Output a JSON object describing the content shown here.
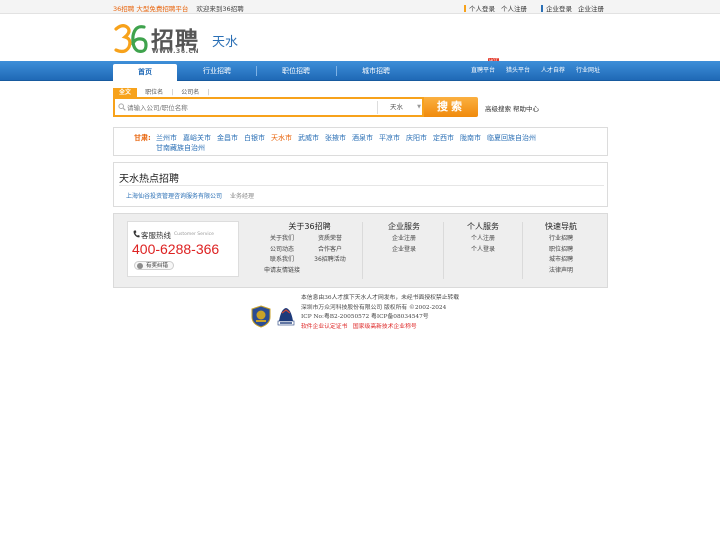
{
  "topbar": {
    "brand": "36招聘 大型免费招聘平台",
    "welcome": "欢迎来到36招聘",
    "personal_login": "个人登录",
    "personal_register": "个人注册",
    "company_login": "企业登录",
    "company_register": "企业注册",
    "personal_bar_color": "#f7a21b",
    "company_bar_color": "#2a6fb5"
  },
  "header": {
    "logo_text": "招聘",
    "logo_url": "WWW.36.CN",
    "city": "天水"
  },
  "nav": {
    "items": [
      {
        "label": "首页",
        "active": true
      },
      {
        "label": "行业招聘",
        "active": false
      },
      {
        "label": "职位招聘",
        "active": false
      },
      {
        "label": "城市招聘",
        "active": false
      }
    ],
    "sub_links": [
      "直聘平台",
      "猎头平台",
      "人才自荐",
      "行业网址"
    ],
    "hot_badge": "HOT"
  },
  "search": {
    "tabs": [
      "全文",
      "职位名",
      "公司名"
    ],
    "placeholder": "请输入公司/职位名称",
    "city": "天水",
    "button": "搜索",
    "advanced": "高级搜索",
    "help": "帮助中心"
  },
  "region": {
    "province": "甘肃:",
    "cities": [
      "兰州市",
      "嘉峪关市",
      "金昌市",
      "白银市",
      "天水市",
      "武威市",
      "张掖市",
      "酒泉市",
      "平凉市",
      "庆阳市",
      "定西市",
      "陇南市",
      "临夏回族自治州",
      "甘南藏族自治州"
    ],
    "current": "天水市"
  },
  "hot": {
    "title": "天水热点招聘",
    "jobs": [
      {
        "company": "上海仙谷投资管理咨询服务有限公司",
        "title": "业务经理"
      }
    ]
  },
  "footer": {
    "service_title": "客服热线",
    "service_en": "Customer Service",
    "phone": "400-6288-366",
    "help_ok": "有奖纠错",
    "about": {
      "title": "关于36招聘",
      "col1": [
        "关于我们",
        "公司动态",
        "联系我们",
        "申请友情链接"
      ],
      "col2": [
        "资质荣誉",
        "合作客户",
        "36招聘活动"
      ]
    },
    "company": {
      "title": "企业服务",
      "links": [
        "企业注册",
        "企业登录"
      ]
    },
    "personal": {
      "title": "个人服务",
      "links": [
        "个人注册",
        "个人登录"
      ]
    },
    "quick": {
      "title": "快速导航",
      "links": [
        "行业招聘",
        "职位招聘",
        "城市招聘",
        "法律声明"
      ]
    }
  },
  "copyright": {
    "line1": "本信息由36人才旗下天水人才网发布，未经书面授权禁止转载",
    "line2": "深圳市万众河科技股份有限公司 版权所有 ©2002-2024",
    "line3": "ICP No:粤B2-20050572    粤ICP备08034547号",
    "cert1": "软件企业认定证书",
    "cert2": "国家级高新技术企业称号"
  }
}
